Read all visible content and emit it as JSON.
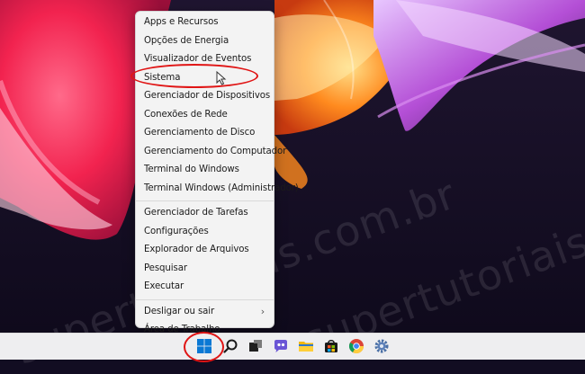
{
  "menu": {
    "items": [
      {
        "label": "Apps e Recursos"
      },
      {
        "label": "Opções de Energia"
      },
      {
        "label": "Visualizador de Eventos"
      },
      {
        "label": "Sistema"
      },
      {
        "label": "Gerenciador de Dispositivos"
      },
      {
        "label": "Conexões de Rede"
      },
      {
        "label": "Gerenciamento de Disco"
      },
      {
        "label": "Gerenciamento do Computador"
      },
      {
        "label": "Terminal do Windows"
      },
      {
        "label": "Terminal Windows (Administrador)"
      },
      {
        "label": "Gerenciador de Tarefas"
      },
      {
        "label": "Configurações"
      },
      {
        "label": "Explorador de Arquivos"
      },
      {
        "label": "Pesquisar"
      },
      {
        "label": "Executar"
      },
      {
        "label": "Desligar ou sair"
      },
      {
        "label": "Área de Trabalho"
      }
    ],
    "submenu_arrow": "›"
  },
  "watermark": {
    "text": "supertutoriais.com.br"
  },
  "taskbar": {
    "icons": [
      "windows-start-icon",
      "search-icon",
      "task-view-icon",
      "chat-icon",
      "file-explorer-icon",
      "store-icon",
      "chrome-icon",
      "settings-icon"
    ]
  },
  "colors": {
    "highlight_ring": "#e01515",
    "menu_bg": "#f3f3f3",
    "taskbar_bg": "#eeeef0",
    "start_blue": "#0a78d4"
  }
}
